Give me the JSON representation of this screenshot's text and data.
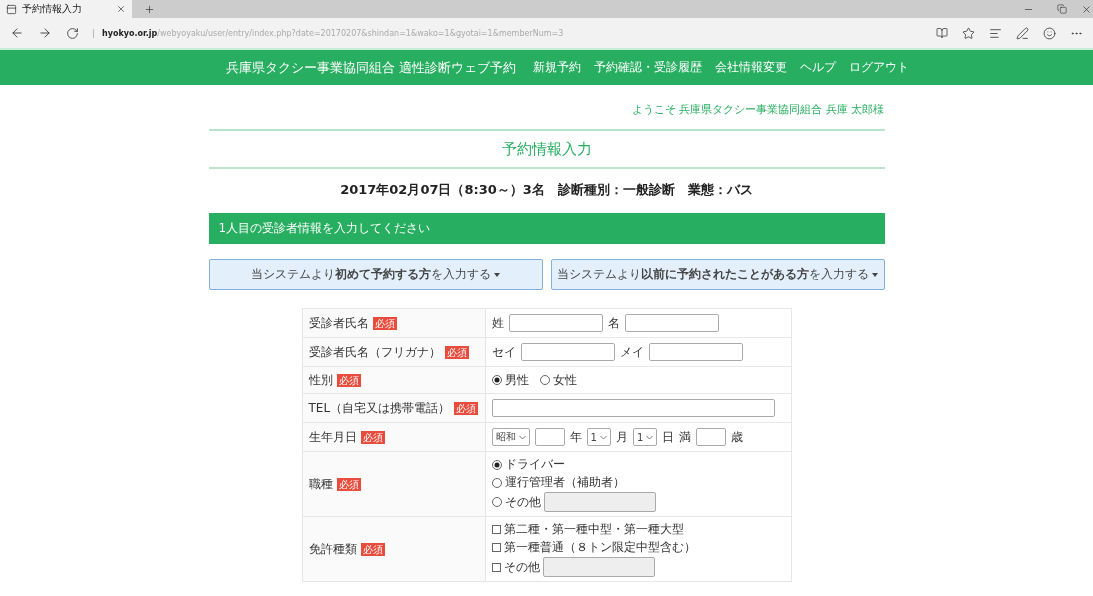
{
  "browser": {
    "tab_title": "予約情報入力",
    "address": {
      "domain": "hyokyo.or.jp",
      "path": "/webyoyaku/user/entry/index.php?date=20170207&shindan=1&wako=1&gyotai=1&memberNum=3"
    }
  },
  "nav": {
    "brand": "兵庫県タクシー事業協同組合 適性診断ウェブ予約",
    "items": [
      "新規予約",
      "予約確認・受診履歴",
      "会社情報変更",
      "ヘルプ",
      "ログアウト"
    ]
  },
  "welcome": "ようこそ 兵庫県タクシー事業協同組合 兵庫 太郎様",
  "page_title": "予約情報入力",
  "summary": "2017年02月07日（8:30～）3名　診断種別：一般診断　業態：バス",
  "section_header": "1人目の受診者情報を入力してください",
  "entry_buttons": [
    {
      "label": "当システムより**初めて予約する方**を入力する"
    },
    {
      "label": "当システムより**以前に予約されたことがある方**を入力する"
    }
  ],
  "form": [
    {
      "label": "受診者氏名",
      "badge": "必須",
      "kind": "parts",
      "parts": [
        {
          "kind": "text",
          "text": "姓"
        },
        {
          "kind": "input"
        },
        {
          "kind": "text",
          "text": "名"
        },
        {
          "kind": "input"
        }
      ]
    },
    {
      "label": "受診者氏名（フリガナ）",
      "badge": "必須",
      "kind": "parts",
      "parts": [
        {
          "kind": "text",
          "text": "セイ"
        },
        {
          "kind": "input"
        },
        {
          "kind": "text",
          "text": "メイ"
        },
        {
          "kind": "input"
        }
      ]
    },
    {
      "label": "性別",
      "badge": "必須",
      "kind": "radio_inline",
      "options": [
        {
          "label": "男性",
          "selected": true
        },
        {
          "label": "女性",
          "selected": false
        }
      ]
    },
    {
      "label": "TEL（自宅又は携帯電話）",
      "badge": "必須",
      "kind": "wide_input"
    },
    {
      "label": "生年月日",
      "badge": "必須",
      "kind": "parts",
      "parts": [
        {
          "kind": "select",
          "value": "昭和"
        },
        {
          "kind": "small_input"
        },
        {
          "kind": "text",
          "text": "年"
        },
        {
          "kind": "select",
          "value": "1"
        },
        {
          "kind": "text",
          "text": "月"
        },
        {
          "kind": "select",
          "value": "1"
        },
        {
          "kind": "text",
          "text": "日"
        },
        {
          "kind": "text",
          "text": "満"
        },
        {
          "kind": "small_input"
        },
        {
          "kind": "text",
          "text": "歳"
        }
      ]
    },
    {
      "label": "職種",
      "badge": "必須",
      "kind": "radio_list",
      "options": [
        {
          "label": "ドライバー",
          "selected": true,
          "kind": "plain"
        },
        {
          "label": "運行管理者（補助者）",
          "selected": false,
          "kind": "plain"
        },
        {
          "label": "その他",
          "selected": false,
          "kind": "with_field"
        }
      ]
    },
    {
      "label": "免許種類",
      "badge": "必須",
      "kind": "check_list",
      "options": [
        {
          "label": "第二種・第一種中型・第一種大型",
          "checked": false,
          "kind": "plain"
        },
        {
          "label": "第一種普通（８トン限定中型含む）",
          "checked": false,
          "kind": "plain"
        },
        {
          "label": "その他",
          "checked": false,
          "kind": "with_field"
        }
      ]
    }
  ]
}
